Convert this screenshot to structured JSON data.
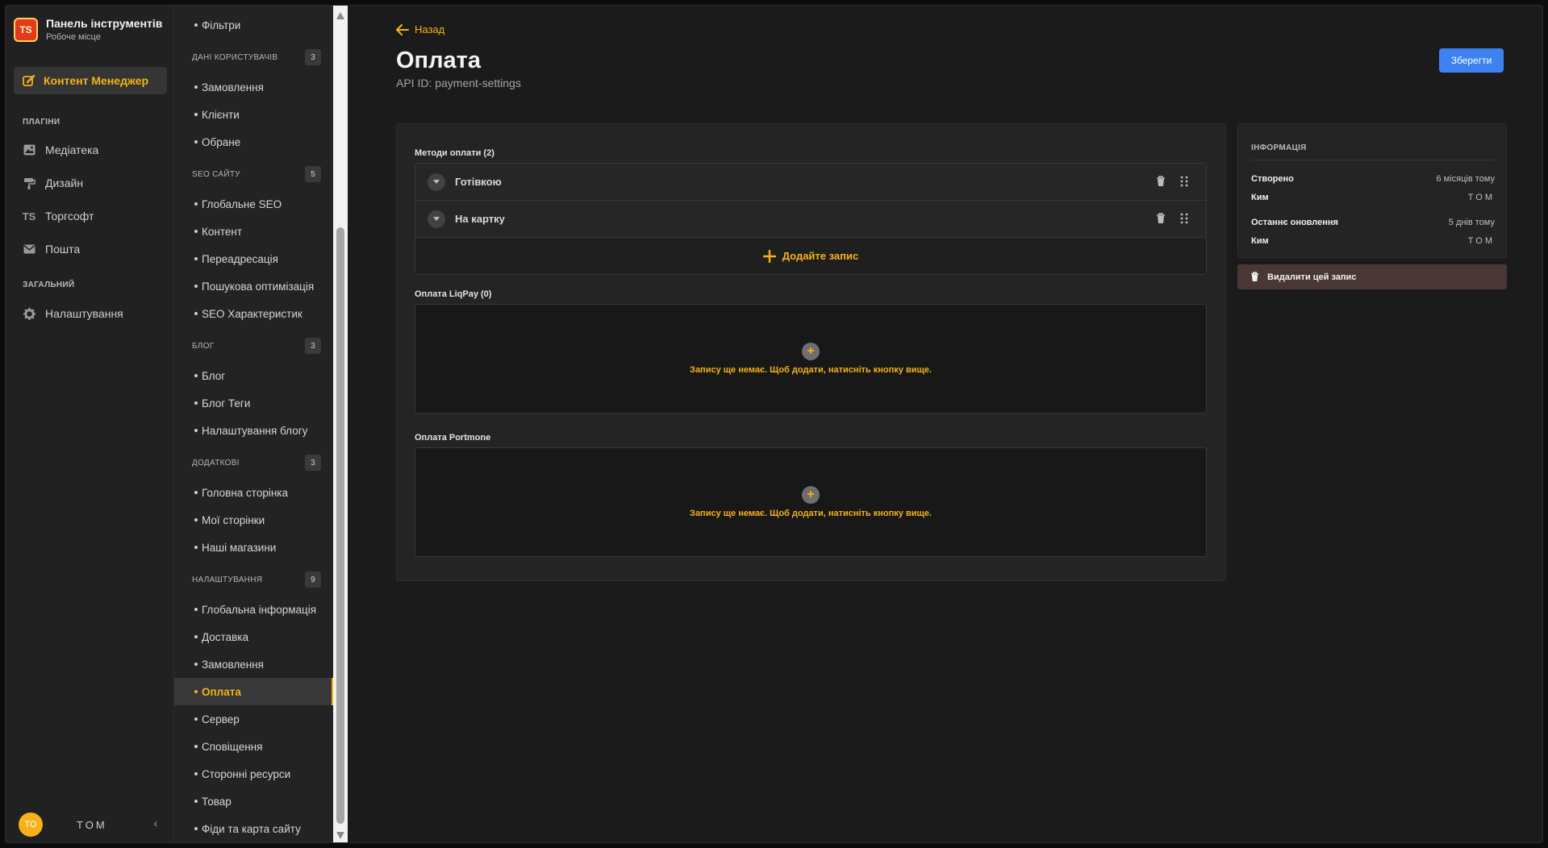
{
  "brand": {
    "title": "Панель інструментів",
    "subtitle": "Робоче місце",
    "logo_text": "TS"
  },
  "nav": {
    "active": "Контент Менеджер",
    "plugins_label": "ПЛАГІНИ",
    "general_label": "ЗАГАЛЬНИЙ",
    "items": [
      {
        "label": "Медіатека",
        "icon": "image-icon"
      },
      {
        "label": "Дизайн",
        "icon": "paint-roller-icon"
      },
      {
        "label": "Торгсофт",
        "icon": "ts-icon"
      },
      {
        "label": "Пошта",
        "icon": "mail-icon"
      }
    ],
    "settings": "Налаштування"
  },
  "user": {
    "initials": "TO",
    "name": "TOM"
  },
  "content_list": {
    "top_item": "Фільтри",
    "groups": [
      {
        "label": "ДАНІ КОРИСТУВАЧІВ",
        "count": "3",
        "items": [
          "Замовлення",
          "Клієнти",
          "Обране"
        ]
      },
      {
        "label": "SEO САЙТУ",
        "count": "5",
        "items": [
          "Глобальне SEO",
          "Контент",
          "Переадресація",
          "Пошукова оптимізація",
          "SEO Характеристик"
        ]
      },
      {
        "label": "БЛОГ",
        "count": "3",
        "items": [
          "Блог",
          "Блог Теги",
          "Налаштування блогу"
        ]
      },
      {
        "label": "ДОДАТКОВІ",
        "count": "3",
        "items": [
          "Головна сторінка",
          "Мої сторінки",
          "Наші магазини"
        ]
      },
      {
        "label": "НАЛАШТУВАННЯ",
        "count": "9",
        "items": [
          "Глобальна інформація",
          "Доставка",
          "Замовлення",
          "Оплата",
          "Сервер",
          "Сповіщення",
          "Сторонні ресурси",
          "Товар",
          "Фіди та карта сайту"
        ]
      }
    ]
  },
  "page": {
    "back": "Назад",
    "title": "Оплата",
    "api_id": "API ID: payment-settings",
    "save": "Зберегти"
  },
  "form": {
    "methods_label": "Методи оплати (2)",
    "methods": [
      "Готівкою",
      "На картку"
    ],
    "add_entry": "Додайте запис",
    "liqpay_label": "Оплата LiqPay (0)",
    "portmone_label": "Оплата Portmone",
    "empty_text": "Запису ще немає. Щоб додати, натисніть кнопку вище."
  },
  "info": {
    "title": "ІНФОРМАЦІЯ",
    "created_label": "Створено",
    "created_value": "6 місяців тому",
    "by_label": "Ким",
    "created_by": "TOM",
    "updated_label": "Останнє оновлення",
    "updated_value": "5 днів тому",
    "updated_by": "TOM",
    "delete": "Видалити цей запис"
  },
  "colors": {
    "accent": "#f5b21a",
    "primary": "#3e82f0",
    "danger_bg": "#4b3636"
  }
}
